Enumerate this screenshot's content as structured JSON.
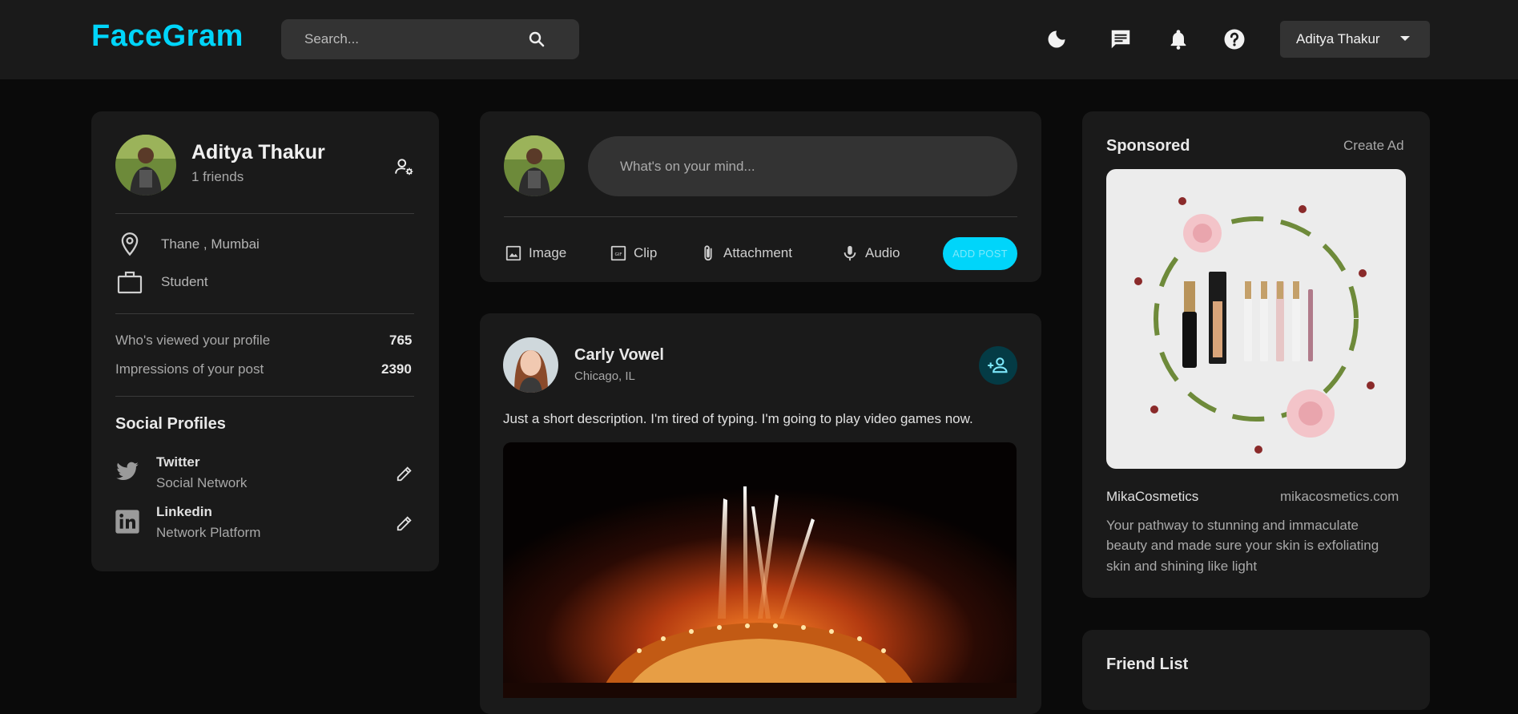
{
  "brand": {
    "name": "FaceGram",
    "accent": "#00d5fa"
  },
  "search": {
    "placeholder": "Search..."
  },
  "nav": {
    "icons": [
      "moon-icon",
      "chat-icon",
      "bell-icon",
      "help-icon"
    ],
    "user_menu": {
      "label": "Aditya Thakur"
    }
  },
  "profile": {
    "name": "Aditya Thakur",
    "friends": "1 friends",
    "location": "Thane , Mumbai",
    "occupation": "Student",
    "stats": [
      {
        "label": "Who's viewed your profile",
        "value": "765"
      },
      {
        "label": "Impressions of your post",
        "value": "2390"
      }
    ],
    "social_title": "Social Profiles",
    "social": [
      {
        "name": "Twitter",
        "desc": "Social Network"
      },
      {
        "name": "Linkedin",
        "desc": "Network Platform"
      }
    ]
  },
  "composer": {
    "placeholder": "What's on your mind...",
    "actions": [
      "Image",
      "Clip",
      "Attachment",
      "Audio"
    ],
    "submit_label": "ADD POST"
  },
  "post": {
    "author": "Carly Vowel",
    "location": "Chicago, IL",
    "description": "Just a short description. I'm tired of typing. I'm going to play video games now."
  },
  "sponsored": {
    "title": "Sponsored",
    "create_ad": "Create Ad",
    "brand": "MikaCosmetics",
    "url": "mikacosmetics.com",
    "text_line1": "Your pathway to stunning and immaculate",
    "text_line2": "beauty and made sure your skin is exfoliating",
    "text_line3": "skin and shining like light"
  },
  "friends": {
    "title": "Friend List"
  }
}
